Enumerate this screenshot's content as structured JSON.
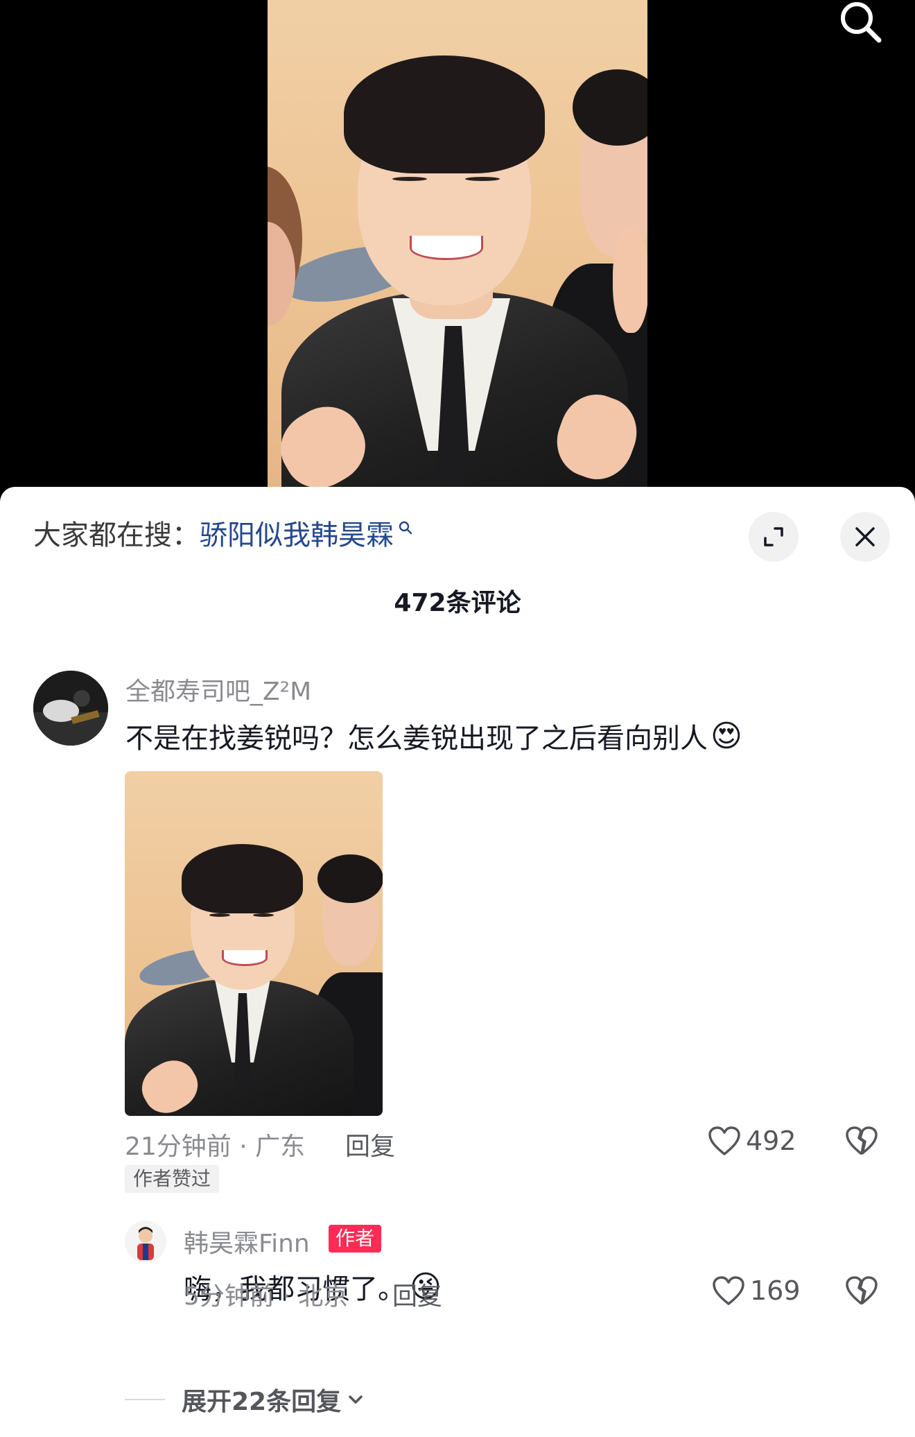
{
  "trending": {
    "prefix": "大家都在搜：",
    "term": "骄阳似我韩昊霖"
  },
  "comments_header": {
    "count_label": "472条评论"
  },
  "comment": {
    "username": "全都寿司吧_Z²M",
    "text": "不是在找姜锐吗？怎么姜锐出现了之后看向别人",
    "emoji": "😍",
    "meta": "21分钟前 · 广东",
    "reply_label": "回复",
    "like_count": "492",
    "author_liked": "作者赞过"
  },
  "reply": {
    "username": "韩昊霖Finn",
    "badge": "作者",
    "text": "嗨，我都习惯了。",
    "emoji": "😜",
    "meta": "5分钟前 · 北京",
    "reply_label": "回复",
    "like_count": "169"
  },
  "expand": {
    "label": "展开22条回复"
  },
  "icons": {
    "search": "search-icon",
    "expand": "expand-icon",
    "close": "close-icon",
    "like": "heart-icon",
    "dislike": "broken-heart-icon",
    "chevron": "chevron-down-icon"
  },
  "colors": {
    "link": "#25488d",
    "badge": "#fe2c55",
    "muted": "#8a8b91"
  }
}
